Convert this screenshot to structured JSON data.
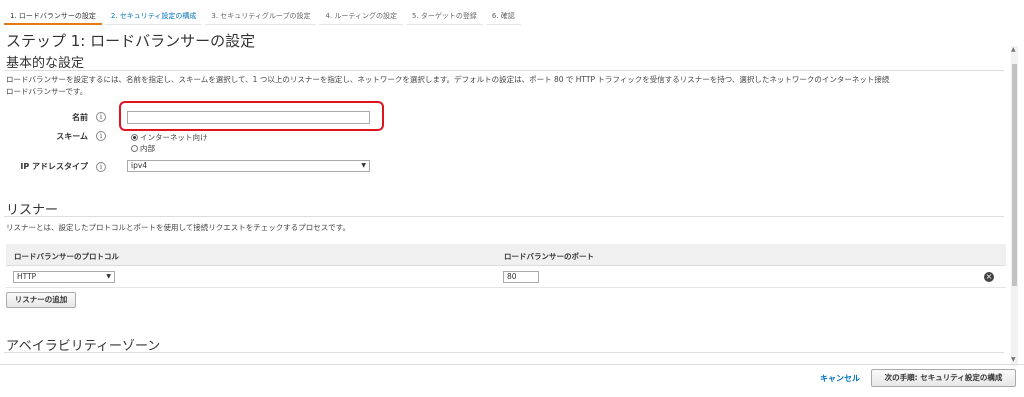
{
  "wizard": {
    "steps": [
      "1. ロードバランサーの設定",
      "2. セキュリティ設定の構成",
      "3. セキュリティグループの設定",
      "4. ルーティングの設定",
      "5. ターゲットの登録",
      "6. 確認"
    ]
  },
  "page_title": "ステップ 1: ロードバランサーの設定",
  "basic": {
    "heading": "基本的な設定",
    "description_line1": "ロードバランサーを設定するには、名前を指定し、スキームを選択して、1 つ以上のリスナーを指定し、ネットワークを選択します。デフォルトの設定は、ポート 80 で HTTP トラフィックを受信するリスナーを持つ、選択したネットワークのインターネット接続",
    "description_line2": "ロードバランサーです。",
    "name_label": "名前",
    "name_value": "",
    "scheme_label": "スキーム",
    "scheme_options": [
      "インターネット向け",
      "内部"
    ],
    "ip_type_label": "IP アドレスタイプ",
    "ip_type_value": "ipv4",
    "info_icon": "i"
  },
  "listeners": {
    "heading": "リスナー",
    "description": "リスナーとは、設定したプロトコルとポートを使用して接続リクエストをチェックするプロセスです。",
    "columns": [
      "ロードバランサーのプロトコル",
      "ロードバランサーのポート"
    ],
    "rows": [
      {
        "protocol": "HTTP",
        "port": "80"
      }
    ],
    "add_button": "リスナーの追加"
  },
  "az": {
    "heading": "アベイラビリティーゾーン"
  },
  "footer": {
    "cancel": "キャンセル",
    "next": "次の手順: セキュリティ設定の構成"
  },
  "colors": {
    "accent": "#e47911",
    "link": "#0073bb",
    "highlight": "#e0141e"
  }
}
